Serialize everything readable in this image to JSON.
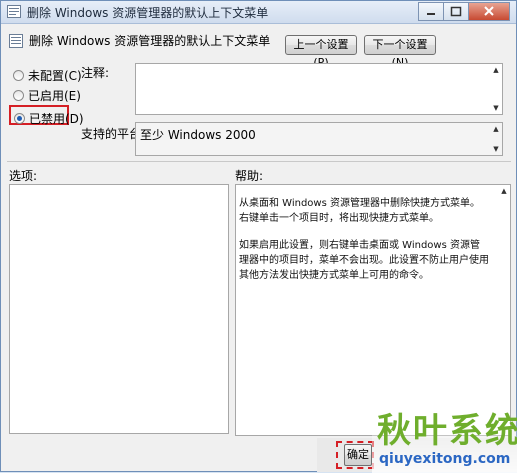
{
  "window": {
    "title": "删除 Windows 资源管理器的默认上下文菜单"
  },
  "header": {
    "policy_title": "删除 Windows 资源管理器的默认上下文菜单",
    "prev_label": "上一个设置(P)",
    "next_label": "下一个设置(N)"
  },
  "options": {
    "not_configured": "未配置(C)",
    "enabled": "已启用(E)",
    "disabled": "已禁用(D)",
    "selected": "disabled"
  },
  "comment": {
    "label": "注释:",
    "value": ""
  },
  "supported": {
    "label": "支持的平台:",
    "value": "至少 Windows 2000"
  },
  "panes": {
    "options_label": "选项:",
    "help_label": "帮助:"
  },
  "help": {
    "para1": "从桌面和 Windows 资源管理器中删除快捷方式菜单。右键单击一个项目时，将出现快捷方式菜单。",
    "para2": "如果启用此设置，则右键单击桌面或 Windows 资源管理器中的项目时，菜单不会出现。此设置不防止用户使用其他方法发出快捷方式菜单上可用的命令。"
  },
  "footer": {
    "ok_label": "确定"
  },
  "watermark": {
    "text": "秋叶系统",
    "url": "qiuyexitong.com"
  },
  "colors": {
    "highlight_border": "#d51f25",
    "watermark_green": "#6fae2d",
    "watermark_blue": "#2b67c3"
  }
}
